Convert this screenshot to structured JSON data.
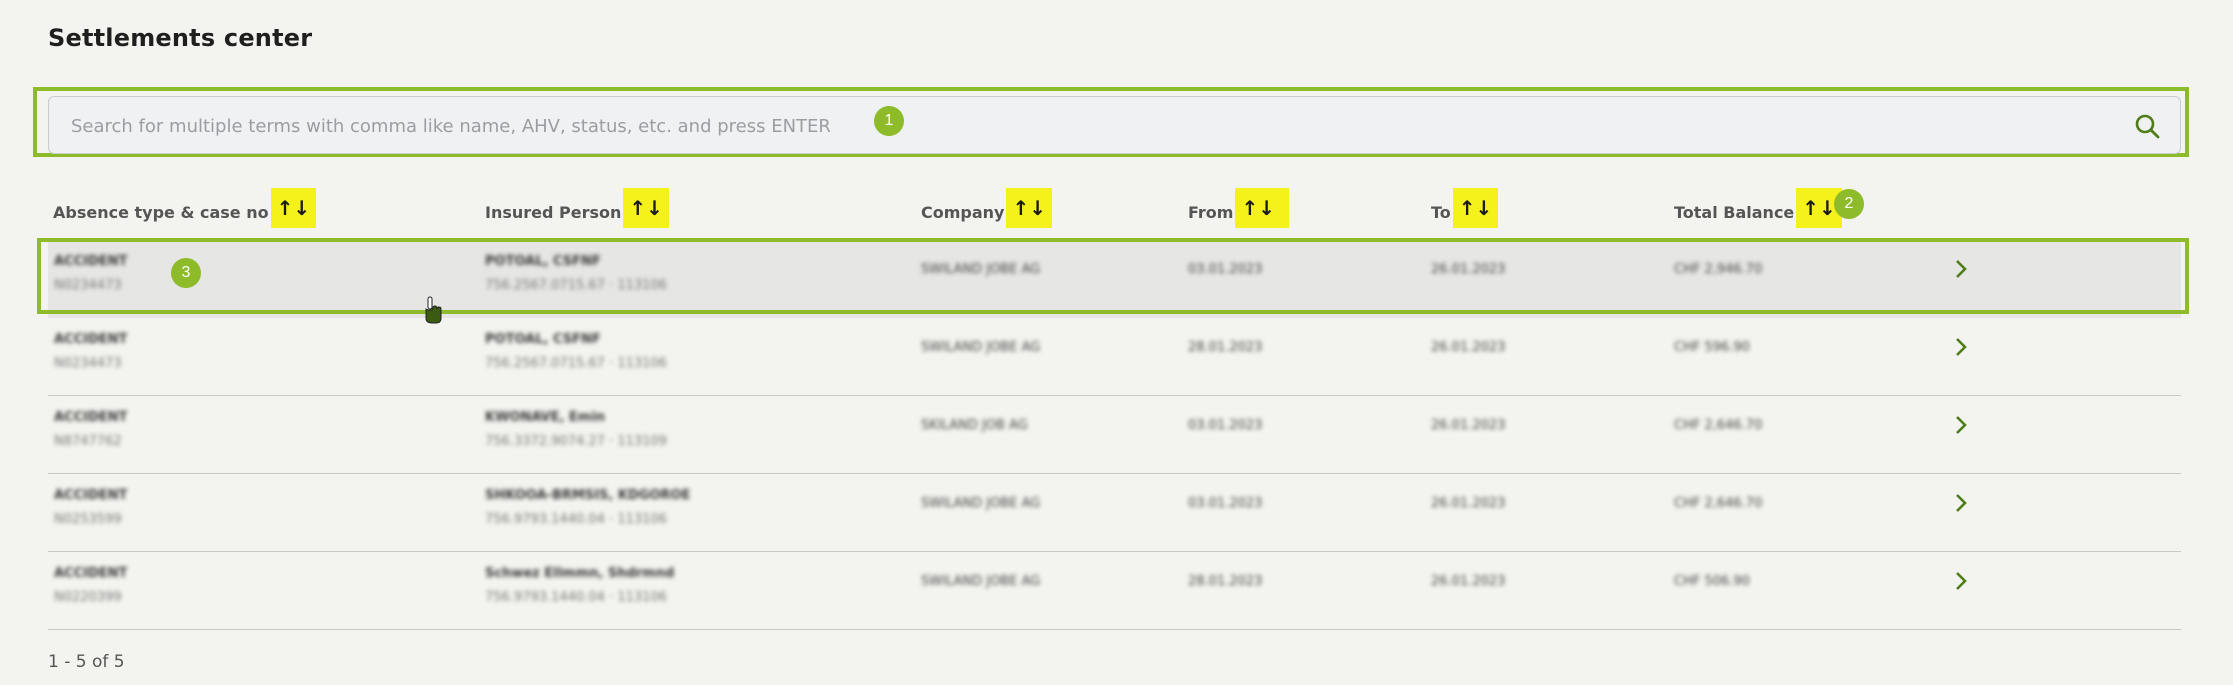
{
  "page": {
    "title": "Settlements center"
  },
  "search": {
    "placeholder": "Search for multiple terms with comma like name, AHV, status, etc. and press ENTER",
    "value": ""
  },
  "badges": {
    "search": "1",
    "sort": "2",
    "row": "3"
  },
  "table": {
    "columns": [
      {
        "label": "Absence type & case no",
        "sort": "↑↓"
      },
      {
        "label": "Insured Person",
        "sort": "↑↓"
      },
      {
        "label": "Company",
        "sort": "↑↓"
      },
      {
        "label": "From",
        "sort": "↑↓"
      },
      {
        "label": "To",
        "sort": "↑↓"
      },
      {
        "label": "Total Balance",
        "sort": "↑↓"
      }
    ],
    "rows": [
      {
        "type": "ACCIDENT",
        "case": "N0234473",
        "person": "POTOAL, CSFNF",
        "ahv": "756.2567.0715.67 · 113106",
        "company": "SWILAND JOBE AG",
        "from": "03.01.2023",
        "to": "26.01.2023",
        "balance": "CHF 2,946.70"
      },
      {
        "type": "ACCIDENT",
        "case": "N0234473",
        "person": "POTOAL, CSFNF",
        "ahv": "756.2567.0715.67 · 113106",
        "company": "SWILAND JOBE AG",
        "from": "28.01.2023",
        "to": "26.01.2023",
        "balance": "CHF 596.90"
      },
      {
        "type": "ACCIDENT",
        "case": "N8747762",
        "person": "KWONAVE, Emin",
        "ahv": "756.3372.9074.27 · 113109",
        "company": "SKILAND JOB AG",
        "from": "03.01.2023",
        "to": "26.01.2023",
        "balance": "CHF 2,646.70"
      },
      {
        "type": "ACCIDENT",
        "case": "N0253599",
        "person": "SHKOOA-BRMSIS, KDGOROE",
        "ahv": "756.9793.1440.04 · 113106",
        "company": "SWILAND JOBE AG",
        "from": "03.01.2023",
        "to": "26.01.2023",
        "balance": "CHF 2,646.70"
      },
      {
        "type": "ACCIDENT",
        "case": "N0220399",
        "person": "Schwez Ellmmn, Shdrmnd",
        "ahv": "756.9793.1440.04 · 113106",
        "company": "SWILAND JOBE AG",
        "from": "28.01.2023",
        "to": "26.01.2023",
        "balance": "CHF 506.90"
      }
    ]
  },
  "pagination": {
    "text": "1 - 5 of 5"
  },
  "colors": {
    "accent": "#8dbb2a",
    "sort_highlight": "#f4f21a",
    "chevron": "#4f7d1a"
  },
  "icons": {
    "search": "search-icon",
    "row_action": "chevron-right-icon",
    "cursor": "hand-cursor-icon"
  }
}
